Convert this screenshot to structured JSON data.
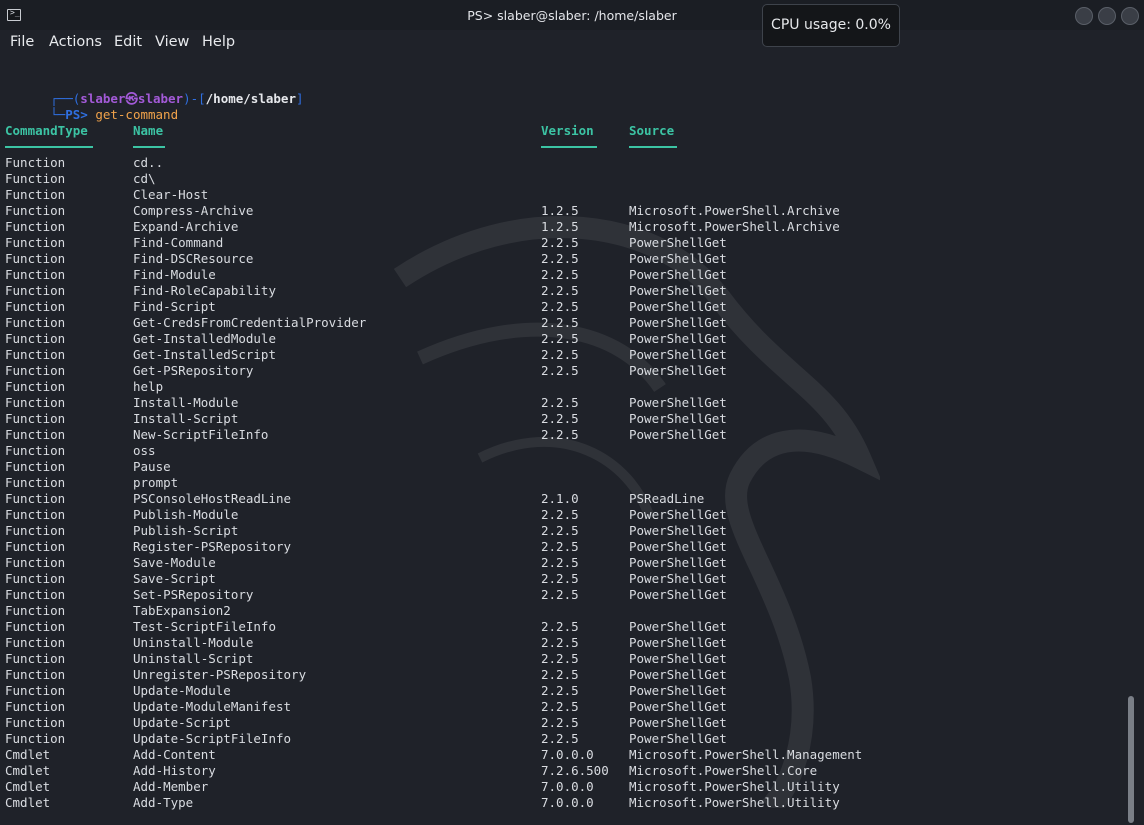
{
  "window": {
    "title": "PS> slaber@slaber: /home/slaber",
    "cpu_tooltip": "CPU usage: 0.0%"
  },
  "menu": [
    "File",
    "Actions",
    "Edit",
    "View",
    "Help"
  ],
  "prompt": {
    "line1_prefix": "┌──(",
    "user": "slaber㉿slaber",
    "line1_mid": ")-[",
    "path": "/home/slaber",
    "line1_suffix": "]",
    "line2_prefix": "└─",
    "ps": "PS>",
    "command": "get-command"
  },
  "table": {
    "headers": [
      "CommandType",
      "Name",
      "Version",
      "Source"
    ],
    "rows": [
      [
        "Function",
        "cd..",
        "",
        ""
      ],
      [
        "Function",
        "cd\\",
        "",
        ""
      ],
      [
        "Function",
        "Clear-Host",
        "",
        ""
      ],
      [
        "Function",
        "Compress-Archive",
        "1.2.5",
        "Microsoft.PowerShell.Archive"
      ],
      [
        "Function",
        "Expand-Archive",
        "1.2.5",
        "Microsoft.PowerShell.Archive"
      ],
      [
        "Function",
        "Find-Command",
        "2.2.5",
        "PowerShellGet"
      ],
      [
        "Function",
        "Find-DSCResource",
        "2.2.5",
        "PowerShellGet"
      ],
      [
        "Function",
        "Find-Module",
        "2.2.5",
        "PowerShellGet"
      ],
      [
        "Function",
        "Find-RoleCapability",
        "2.2.5",
        "PowerShellGet"
      ],
      [
        "Function",
        "Find-Script",
        "2.2.5",
        "PowerShellGet"
      ],
      [
        "Function",
        "Get-CredsFromCredentialProvider",
        "2.2.5",
        "PowerShellGet"
      ],
      [
        "Function",
        "Get-InstalledModule",
        "2.2.5",
        "PowerShellGet"
      ],
      [
        "Function",
        "Get-InstalledScript",
        "2.2.5",
        "PowerShellGet"
      ],
      [
        "Function",
        "Get-PSRepository",
        "2.2.5",
        "PowerShellGet"
      ],
      [
        "Function",
        "help",
        "",
        ""
      ],
      [
        "Function",
        "Install-Module",
        "2.2.5",
        "PowerShellGet"
      ],
      [
        "Function",
        "Install-Script",
        "2.2.5",
        "PowerShellGet"
      ],
      [
        "Function",
        "New-ScriptFileInfo",
        "2.2.5",
        "PowerShellGet"
      ],
      [
        "Function",
        "oss",
        "",
        ""
      ],
      [
        "Function",
        "Pause",
        "",
        ""
      ],
      [
        "Function",
        "prompt",
        "",
        ""
      ],
      [
        "Function",
        "PSConsoleHostReadLine",
        "2.1.0",
        "PSReadLine"
      ],
      [
        "Function",
        "Publish-Module",
        "2.2.5",
        "PowerShellGet"
      ],
      [
        "Function",
        "Publish-Script",
        "2.2.5",
        "PowerShellGet"
      ],
      [
        "Function",
        "Register-PSRepository",
        "2.2.5",
        "PowerShellGet"
      ],
      [
        "Function",
        "Save-Module",
        "2.2.5",
        "PowerShellGet"
      ],
      [
        "Function",
        "Save-Script",
        "2.2.5",
        "PowerShellGet"
      ],
      [
        "Function",
        "Set-PSRepository",
        "2.2.5",
        "PowerShellGet"
      ],
      [
        "Function",
        "TabExpansion2",
        "",
        ""
      ],
      [
        "Function",
        "Test-ScriptFileInfo",
        "2.2.5",
        "PowerShellGet"
      ],
      [
        "Function",
        "Uninstall-Module",
        "2.2.5",
        "PowerShellGet"
      ],
      [
        "Function",
        "Uninstall-Script",
        "2.2.5",
        "PowerShellGet"
      ],
      [
        "Function",
        "Unregister-PSRepository",
        "2.2.5",
        "PowerShellGet"
      ],
      [
        "Function",
        "Update-Module",
        "2.2.5",
        "PowerShellGet"
      ],
      [
        "Function",
        "Update-ModuleManifest",
        "2.2.5",
        "PowerShellGet"
      ],
      [
        "Function",
        "Update-Script",
        "2.2.5",
        "PowerShellGet"
      ],
      [
        "Function",
        "Update-ScriptFileInfo",
        "2.2.5",
        "PowerShellGet"
      ],
      [
        "Cmdlet",
        "Add-Content",
        "7.0.0.0",
        "Microsoft.PowerShell.Management"
      ],
      [
        "Cmdlet",
        "Add-History",
        "7.2.6.500",
        "Microsoft.PowerShell.Core"
      ],
      [
        "Cmdlet",
        "Add-Member",
        "7.0.0.0",
        "Microsoft.PowerShell.Utility"
      ],
      [
        "Cmdlet",
        "Add-Type",
        "7.0.0.0",
        "Microsoft.PowerShell.Utility"
      ]
    ]
  },
  "colors": {
    "background": "#1f2229",
    "header_teal": "#3cc4a4",
    "prompt_blue": "#2f6fe0",
    "prompt_user_purple": "#a35ad8",
    "command_orange": "#f0a24a",
    "text": "#d9dce1"
  },
  "icons": {
    "app": "terminal-icon",
    "minimize": "minimize-icon",
    "maximize": "maximize-icon",
    "close": "close-icon"
  }
}
